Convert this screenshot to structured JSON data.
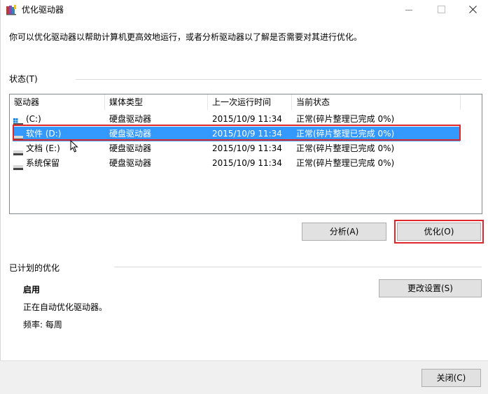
{
  "window": {
    "title": "优化驱动器",
    "icon": "defrag-app-icon"
  },
  "intro": "你可以优化驱动器以帮助计算机更高效地运行，或者分析驱动器以了解是否需要对其进行优化。",
  "status": {
    "label": "状态(T)",
    "columns": [
      "驱动器",
      "媒体类型",
      "上一次运行时间",
      "当前状态"
    ],
    "rows": [
      {
        "drive": "(C:)",
        "media": "硬盘驱动器",
        "last_run": "2015/10/9 11:34",
        "state": "正常(碎片整理已完成 0%)",
        "icon": "windows-drive-icon"
      },
      {
        "drive": "软件 (D:)",
        "media": "硬盘驱动器",
        "last_run": "2015/10/9 11:34",
        "state": "正常(碎片整理已完成 0%)",
        "icon": "hard-drive-icon",
        "selected": true
      },
      {
        "drive": "文档 (E:)",
        "media": "硬盘驱动器",
        "last_run": "2015/10/9 11:34",
        "state": "正常(碎片整理已完成 0%)",
        "icon": "hard-drive-icon"
      },
      {
        "drive": "系统保留",
        "media": "硬盘驱动器",
        "last_run": "2015/10/9 11:34",
        "state": "正常(碎片整理已完成 0%)",
        "icon": "hard-drive-icon"
      }
    ],
    "analyze_button": "分析(A)",
    "optimize_button": "优化(O)"
  },
  "scheduled": {
    "label": "已计划的优化",
    "state": "启用",
    "description": "正在自动优化驱动器。",
    "frequency": "频率: 每周",
    "change_button": "更改设置(S)"
  },
  "footer": {
    "close_button": "关闭(C)"
  },
  "colors": {
    "selection": "#3399ff",
    "highlight_box": "#e0262b",
    "button_face": "#e1e1e1",
    "footer_bg": "#f0f0f0"
  }
}
